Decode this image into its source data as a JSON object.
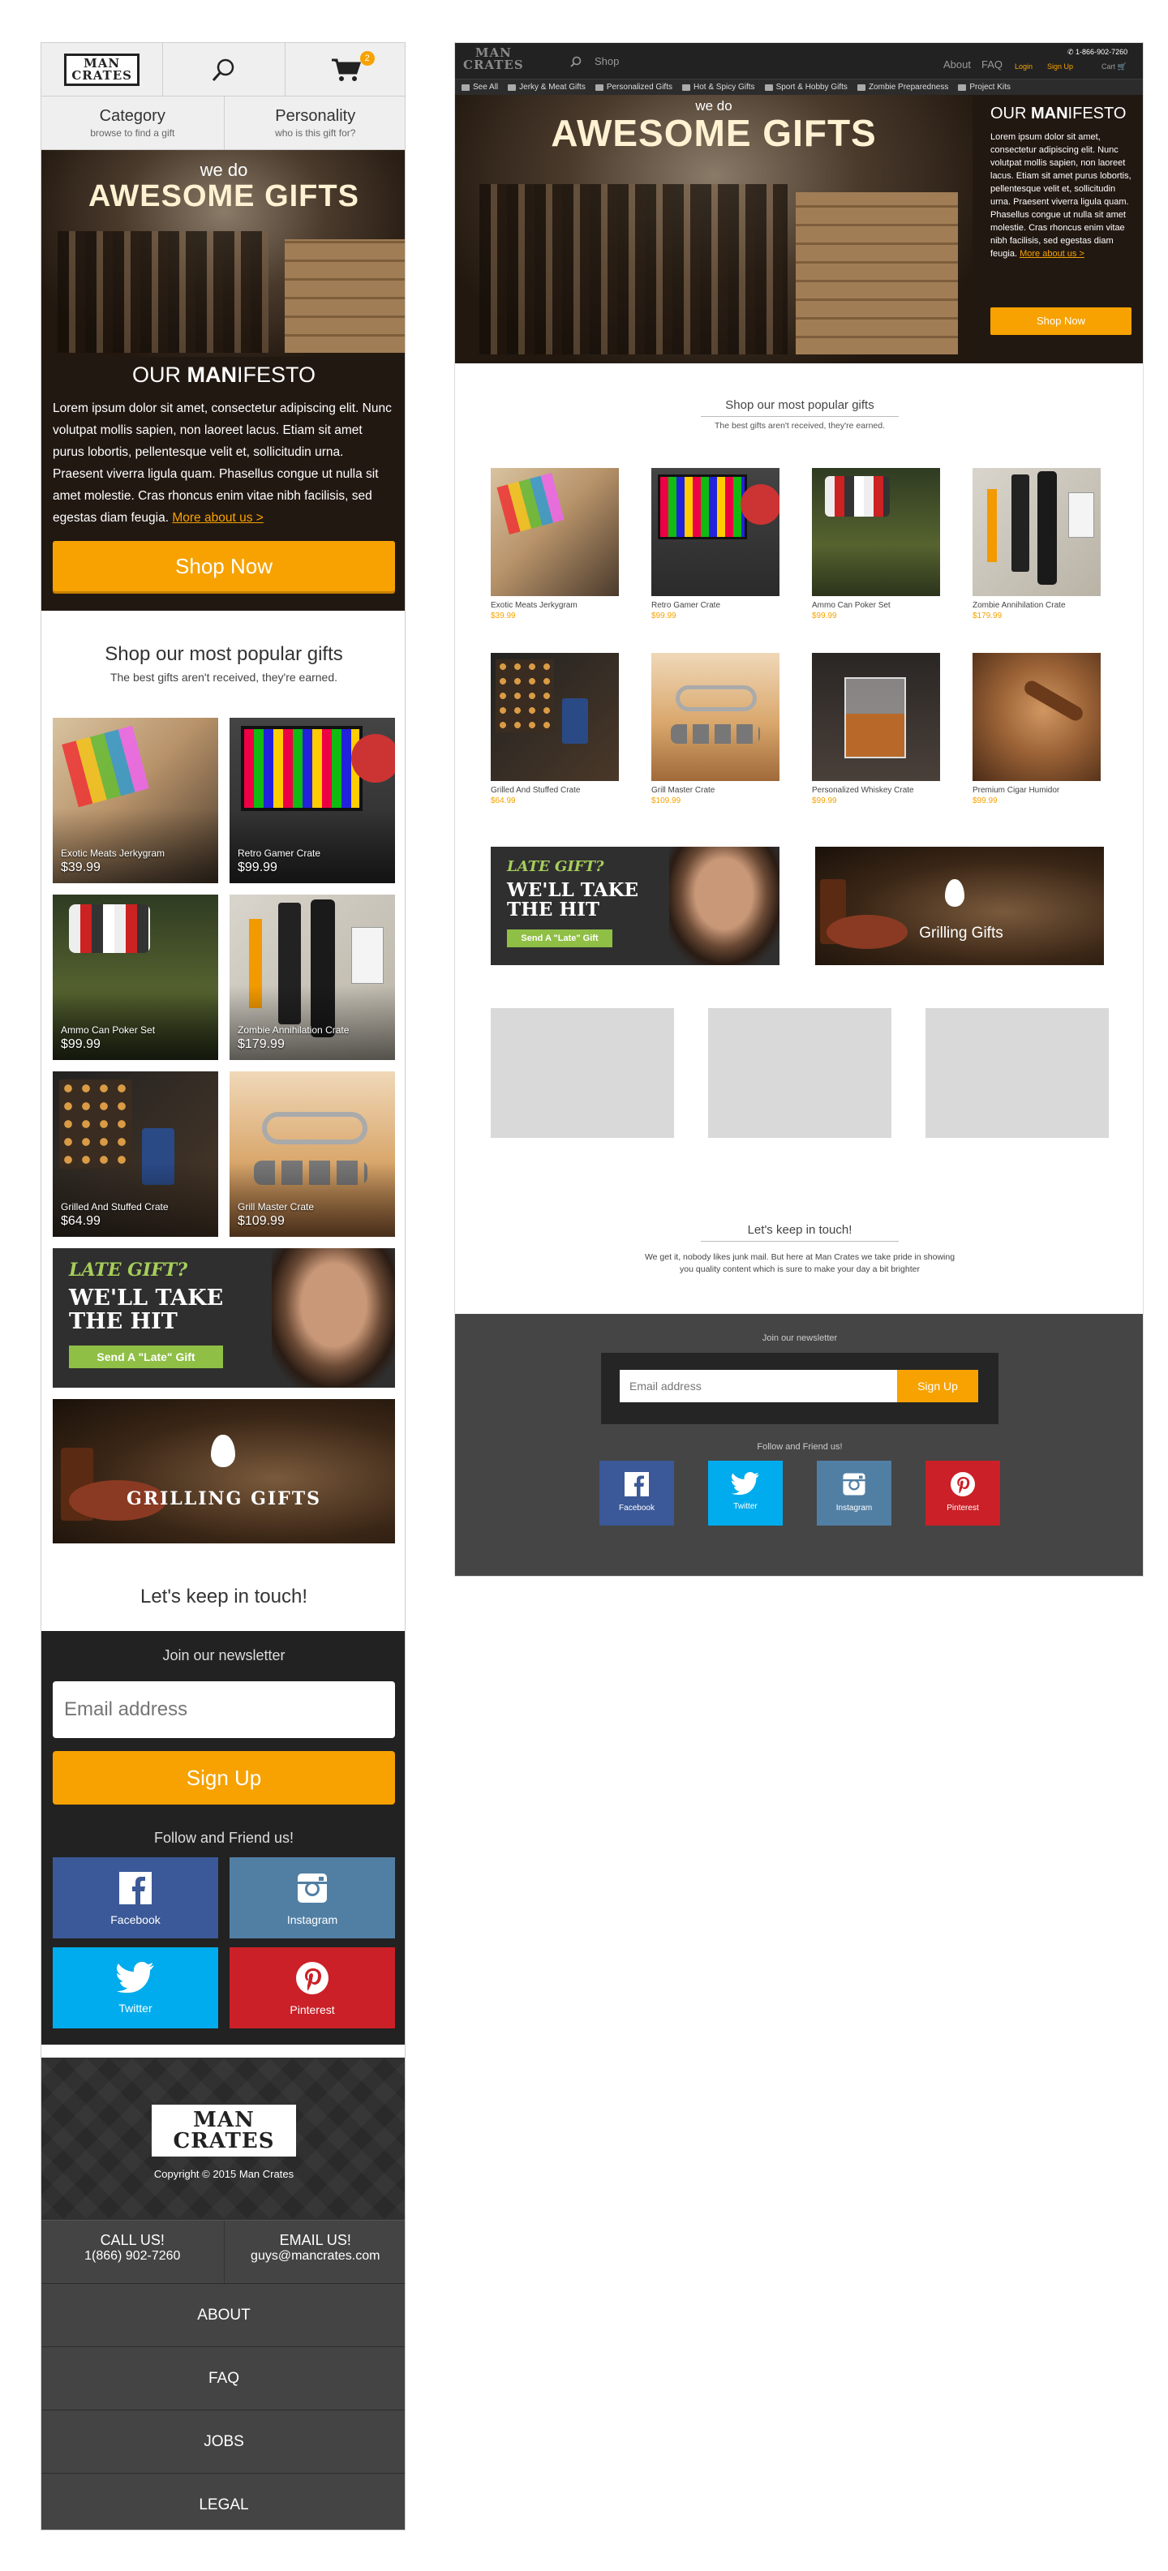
{
  "brand": {
    "logo_line1": "MAN",
    "logo_line2": "CRATES",
    "accent": "#f7a200",
    "dark": "#222222"
  },
  "mobile": {
    "cart_count": "2",
    "filters": [
      {
        "title": "Category",
        "sub": "browse to find a gift"
      },
      {
        "title": "Personality",
        "sub": "who is this gift for?"
      }
    ],
    "hero": {
      "we_do": "we do",
      "headline": "AWESOME GIFTS",
      "manifesto_pre": "OUR ",
      "manifesto_bold": "MAN",
      "manifesto_post": "IFESTO",
      "body": "Lorem ipsum dolor sit amet, consectetur adipiscing elit. Nunc volutpat mollis sapien, non laoreet lacus. Etiam sit amet purus lobortis, pellentesque velit et, sollicitudin urna. Praesent viverra ligula quam. Phasellus congue ut nulla sit amet molestie. Cras rhoncus enim vitae nibh facilisis, sed egestas diam feugia.",
      "more_link": "More about us >",
      "cta": "Shop Now"
    },
    "popular_title": "Shop our most popular gifts",
    "popular_sub": "The best gifts aren't received, they're earned.",
    "products": [
      {
        "name": "Exotic Meats Jerkygram",
        "price": "$39.99"
      },
      {
        "name": "Retro Gamer Crate",
        "price": "$99.99"
      },
      {
        "name": "Ammo Can Poker Set",
        "price": "$99.99"
      },
      {
        "name": "Zombie Annihilation Crate",
        "price": "$179.99"
      },
      {
        "name": "Grilled And Stuffed Crate",
        "price": "$64.99"
      },
      {
        "name": "Grill Master Crate",
        "price": "$109.99"
      }
    ],
    "late_banner": {
      "line1": "LATE GIFT?",
      "line2": "WE'LL TAKE",
      "line3": "THE HIT",
      "button": "Send A \"Late\" Gift"
    },
    "grill_banner": {
      "text": "GRILLING GIFTS"
    },
    "keep_in_touch": "Let's keep in touch!",
    "newsletter": {
      "heading": "Join our newsletter",
      "placeholder": "Email address",
      "button": "Sign Up",
      "follow": "Follow and Friend us!"
    },
    "social": [
      {
        "label": "Facebook",
        "color": "#3b5998"
      },
      {
        "label": "Instagram",
        "color": "#517fa4"
      },
      {
        "label": "Twitter",
        "color": "#00aced"
      },
      {
        "label": "Pinterest",
        "color": "#cb2027"
      }
    ],
    "footer": {
      "copyright": "Copyright © 2015 Man Crates",
      "call_label": "CALL US!",
      "call_value": "1(866) 902-7260",
      "email_label": "EMAIL US!",
      "email_value": "guys@mancrates.com",
      "links": [
        "ABOUT",
        "FAQ",
        "JOBS",
        "LEGAL"
      ]
    }
  },
  "desktop": {
    "nav": {
      "shop": "Shop",
      "about": "About",
      "faq": "FAQ",
      "phone": "1-866-902-7260",
      "login": "Login",
      "signup": "Sign Up",
      "cart": "Cart"
    },
    "categories": [
      "See All",
      "Jerky & Meat Gifts",
      "Personalized Gifts",
      "Hot & Spicy Gifts",
      "Sport & Hobby Gifts",
      "Zombie Preparedness",
      "Project Kits"
    ],
    "hero": {
      "we_do": "we do",
      "headline": "AWESOME GIFTS",
      "manifesto_pre": "OUR ",
      "manifesto_bold": "MAN",
      "manifesto_post": "IFESTO",
      "body": "Lorem ipsum dolor sit amet, consectetur adipiscing elit. Nunc volutpat mollis sapien, non laoreet lacus. Etiam sit amet purus lobortis, pellentesque velit et, sollicitudin urna. Praesent viverra ligula quam. Phasellus congue ut nulla sit amet molestie. Cras rhoncus enim vitae nibh facilisis, sed egestas diam feugia.",
      "more_link": "More about us >",
      "cta": "Shop Now"
    },
    "popular_title": "Shop our most popular gifts",
    "popular_sub": "The best gifts aren't received, they're earned.",
    "products": [
      {
        "name": "Exotic Meats Jerkygram",
        "price": "$39.99"
      },
      {
        "name": "Retro Gamer Crate",
        "price": "$99.99"
      },
      {
        "name": "Ammo Can Poker Set",
        "price": "$99.99"
      },
      {
        "name": "Zombie Annihilation Crate",
        "price": "$179.99"
      },
      {
        "name": "Grilled And Stuffed Crate",
        "price": "$64.99"
      },
      {
        "name": "Grill Master Crate",
        "price": "$109.99"
      },
      {
        "name": "Personalized Whiskey Crate",
        "price": "$99.99"
      },
      {
        "name": "Premium Cigar Humidor",
        "price": "$99.99"
      }
    ],
    "late_banner": {
      "line1": "LATE GIFT?",
      "line2": "WE'LL TAKE",
      "line3": "THE HIT",
      "button": "Send A \"Late\" Gift"
    },
    "grill_banner": {
      "text": "Grilling Gifts"
    },
    "keep_in_touch": "Let's keep in touch!",
    "keep_sub": "We get it, nobody likes junk mail. But here at Man Crates we take pride in showing you quality content which is sure to make your day a bit brighter",
    "newsletter": {
      "heading": "Join our newsletter",
      "placeholder": "Email address",
      "button": "Sign Up",
      "follow": "Follow and Friend us!"
    },
    "social": [
      {
        "label": "Facebook",
        "color": "#3b5998"
      },
      {
        "label": "Twitter",
        "color": "#00aced"
      },
      {
        "label": "Instagram",
        "color": "#517fa4"
      },
      {
        "label": "Pinterest",
        "color": "#cb2027"
      }
    ]
  }
}
